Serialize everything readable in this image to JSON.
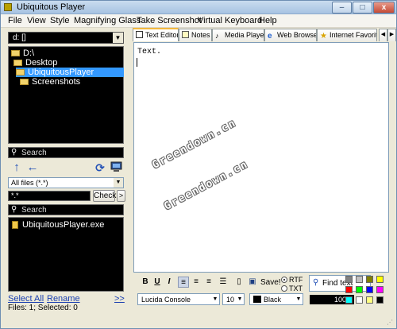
{
  "window": {
    "title": "Ubiquitous Player",
    "controls": {
      "minimize": "–",
      "maximize": "□",
      "close": "x"
    }
  },
  "menu": [
    "File",
    "View",
    "Style",
    "Magnifying Glass",
    "Take Screenshot",
    "Virtual Keyboard",
    "Help"
  ],
  "left": {
    "drive": "d: []",
    "tree": [
      {
        "label": "D:\\",
        "selected": false
      },
      {
        "label": "Desktop",
        "selected": false
      },
      {
        "label": "UbiquitousPlayer",
        "selected": true
      },
      {
        "label": "Screenshots",
        "selected": false
      }
    ],
    "folder_search_placeholder": "Search",
    "file_filter": "All files (*.*)",
    "mask_value": "*.*",
    "check_label": "Check",
    "more_label": ">",
    "file_search_placeholder": "Search",
    "files": [
      "UbiquitousPlayer.exe"
    ],
    "select_all": "Select All",
    "rename": "Rename",
    "more_link": ">>",
    "status": "Files: 1; Selected: 0",
    "icons": {
      "up": "up-arrow-icon",
      "back": "back-arrow-icon",
      "refresh": "refresh-icon",
      "computer": "computer-icon"
    }
  },
  "tabs": [
    {
      "label": "Text Editor",
      "icon": "text-editor-icon",
      "active": true
    },
    {
      "label": "Notes",
      "icon": "notes-icon",
      "active": false
    },
    {
      "label": "Media Player",
      "icon": "music-note-icon",
      "active": false
    },
    {
      "label": "Web Browser",
      "icon": "browser-icon",
      "active": false
    },
    {
      "label": "Internet Favorites",
      "icon": "star-icon",
      "active": false
    }
  ],
  "editor": {
    "content": "Text."
  },
  "watermark": [
    "Greendown.cn",
    "Greendown.cn"
  ],
  "format": {
    "bold": "B",
    "underline": "U",
    "italic": "I",
    "save_label": "Save!",
    "rtf_label": "RTF",
    "txt_label": "TXT",
    "selected_format": "RTF",
    "find_placeholder": "Find text",
    "font": "Lucida Console",
    "size": "10",
    "color_name": "Black",
    "zoom": "100%"
  },
  "colors": {
    "accent": "#3399ff",
    "palette": [
      "#808080",
      "#c0c0c0",
      "#808000",
      "#ffff00",
      "#ff0000",
      "#00ff00",
      "#0000ff",
      "#ff00ff",
      "#00ffff",
      "#ffffff",
      "#ffff80",
      "#000000"
    ]
  }
}
